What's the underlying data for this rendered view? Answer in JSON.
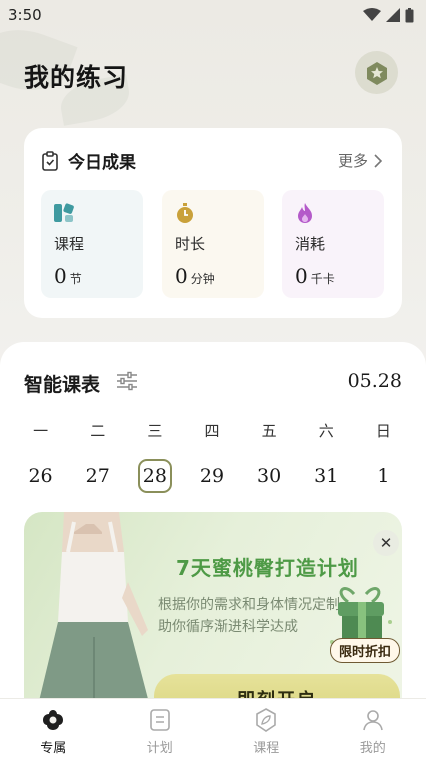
{
  "status_bar": {
    "time": "3:50"
  },
  "header": {
    "title": "我的练习"
  },
  "today": {
    "title": "今日成果",
    "more": "更多",
    "stats": [
      {
        "label": "课程",
        "value": "0",
        "unit": "节",
        "icon": "course-icon",
        "color": "#3f9aa0"
      },
      {
        "label": "时长",
        "value": "0",
        "unit": "分钟",
        "icon": "stopwatch-icon",
        "color": "#c9a13a"
      },
      {
        "label": "消耗",
        "value": "0",
        "unit": "千卡",
        "icon": "flame-icon",
        "color": "#b45ac9"
      }
    ]
  },
  "schedule": {
    "title": "智能课表",
    "date": "05.28",
    "weekdays": [
      "一",
      "二",
      "三",
      "四",
      "五",
      "六",
      "日"
    ],
    "days": [
      "26",
      "27",
      "28",
      "29",
      "30",
      "31",
      "1"
    ],
    "selected_day": "28"
  },
  "promo": {
    "title": "7天蜜桃臀打造计划",
    "description": "根据你的需求和身体情况定制,助你循序渐进科学达成",
    "tag": "限时折扣",
    "cta": "即刻开启"
  },
  "tabs": [
    {
      "label": "专属",
      "icon": "exclusive-icon",
      "active": true
    },
    {
      "label": "计划",
      "icon": "plan-icon",
      "active": false
    },
    {
      "label": "课程",
      "icon": "course-tab-icon",
      "active": false
    },
    {
      "label": "我的",
      "icon": "profile-icon",
      "active": false
    }
  ],
  "colors": {
    "accent": "#8a8f5a",
    "promo_title": "#4e9a46"
  }
}
